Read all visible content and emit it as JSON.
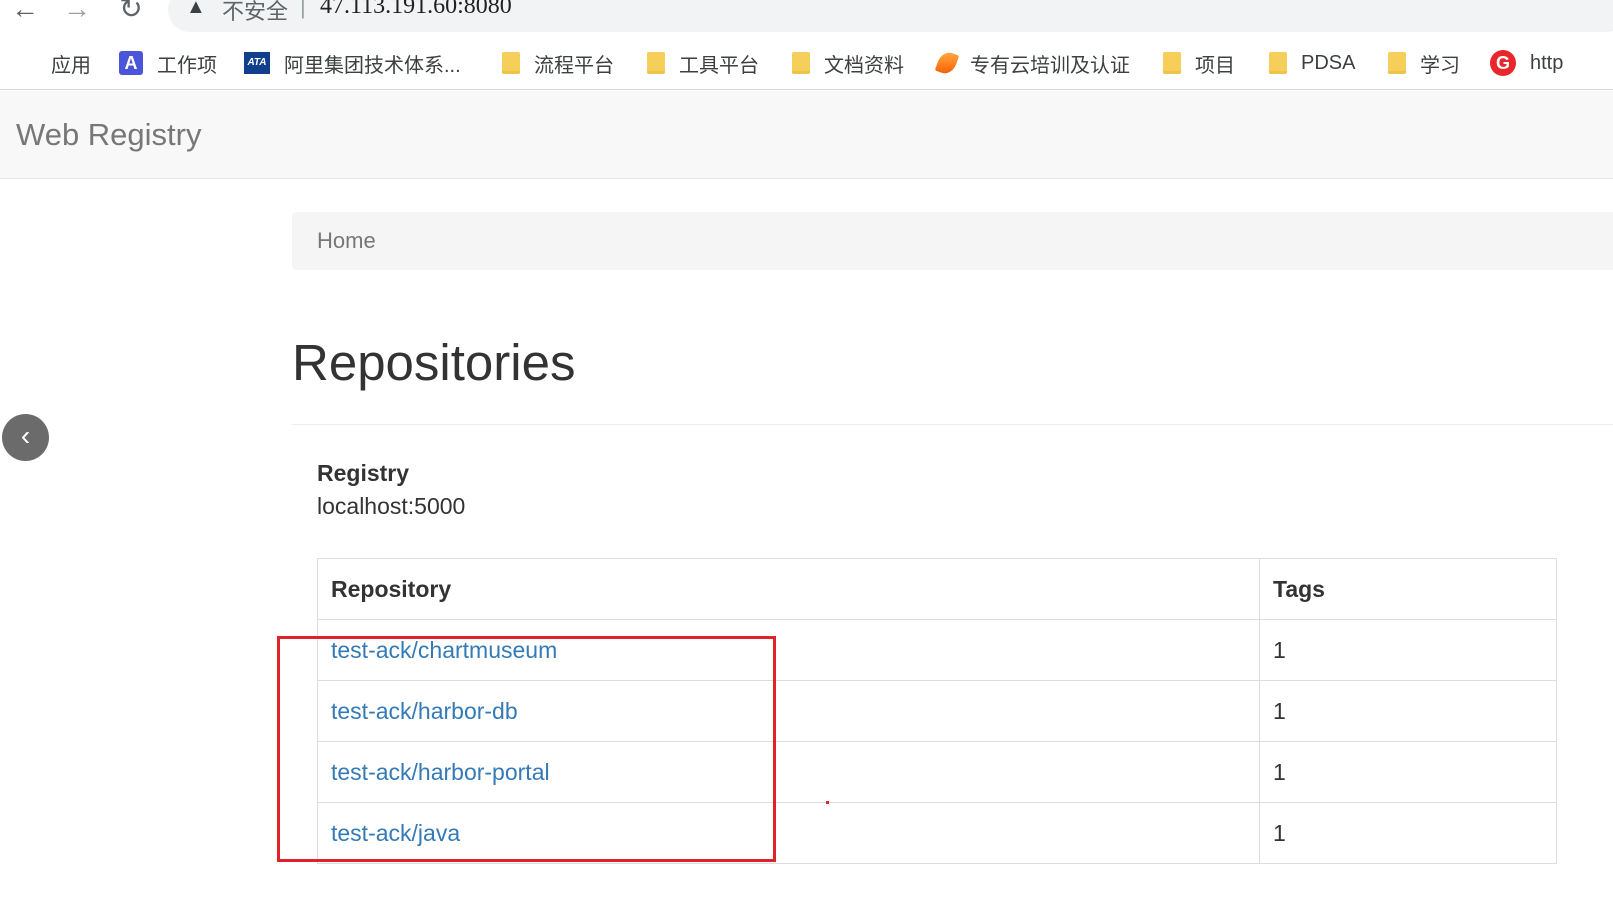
{
  "browser": {
    "back_glyph": "←",
    "forward_glyph": "→",
    "reload_glyph": "↻",
    "warning_glyph": "▲",
    "security_text": "不安全",
    "separator": "|",
    "url": "47.113.191.60:8080"
  },
  "bookmarks": [
    {
      "label": "应用",
      "icon": "apps-grid-icon"
    },
    {
      "label": "工作项",
      "icon": "a-app-icon",
      "glyph": "A"
    },
    {
      "label": "阿里集团技术体系...",
      "icon": "ata-icon",
      "glyph": "ATA"
    },
    {
      "label": "流程平台",
      "icon": "folder-icon"
    },
    {
      "label": "工具平台",
      "icon": "folder-icon"
    },
    {
      "label": "文档资料",
      "icon": "folder-icon"
    },
    {
      "label": "专有云培训及认证",
      "icon": "flame-icon"
    },
    {
      "label": "项目",
      "icon": "folder-icon"
    },
    {
      "label": "PDSA",
      "icon": "folder-icon"
    },
    {
      "label": "学习",
      "icon": "folder-icon"
    },
    {
      "label": "http",
      "icon": "g-icon",
      "glyph": "G"
    }
  ],
  "navbar": {
    "brand": "Web Registry"
  },
  "breadcrumb": {
    "home": "Home"
  },
  "main": {
    "title": "Repositories",
    "registry_label": "Registry",
    "registry_value": "localhost:5000",
    "table": {
      "headers": [
        "Repository",
        "Tags"
      ],
      "rows": [
        {
          "repository": "test-ack/chartmuseum",
          "tags": "1"
        },
        {
          "repository": "test-ack/harbor-db",
          "tags": "1"
        },
        {
          "repository": "test-ack/harbor-portal",
          "tags": "1"
        },
        {
          "repository": "test-ack/java",
          "tags": "1"
        }
      ]
    }
  },
  "side_toggle_glyph": "‹",
  "colors": {
    "link": "#337ab7",
    "highlight": "#e0232b",
    "brand_text": "#777777",
    "folder": "#f6cf5b"
  }
}
